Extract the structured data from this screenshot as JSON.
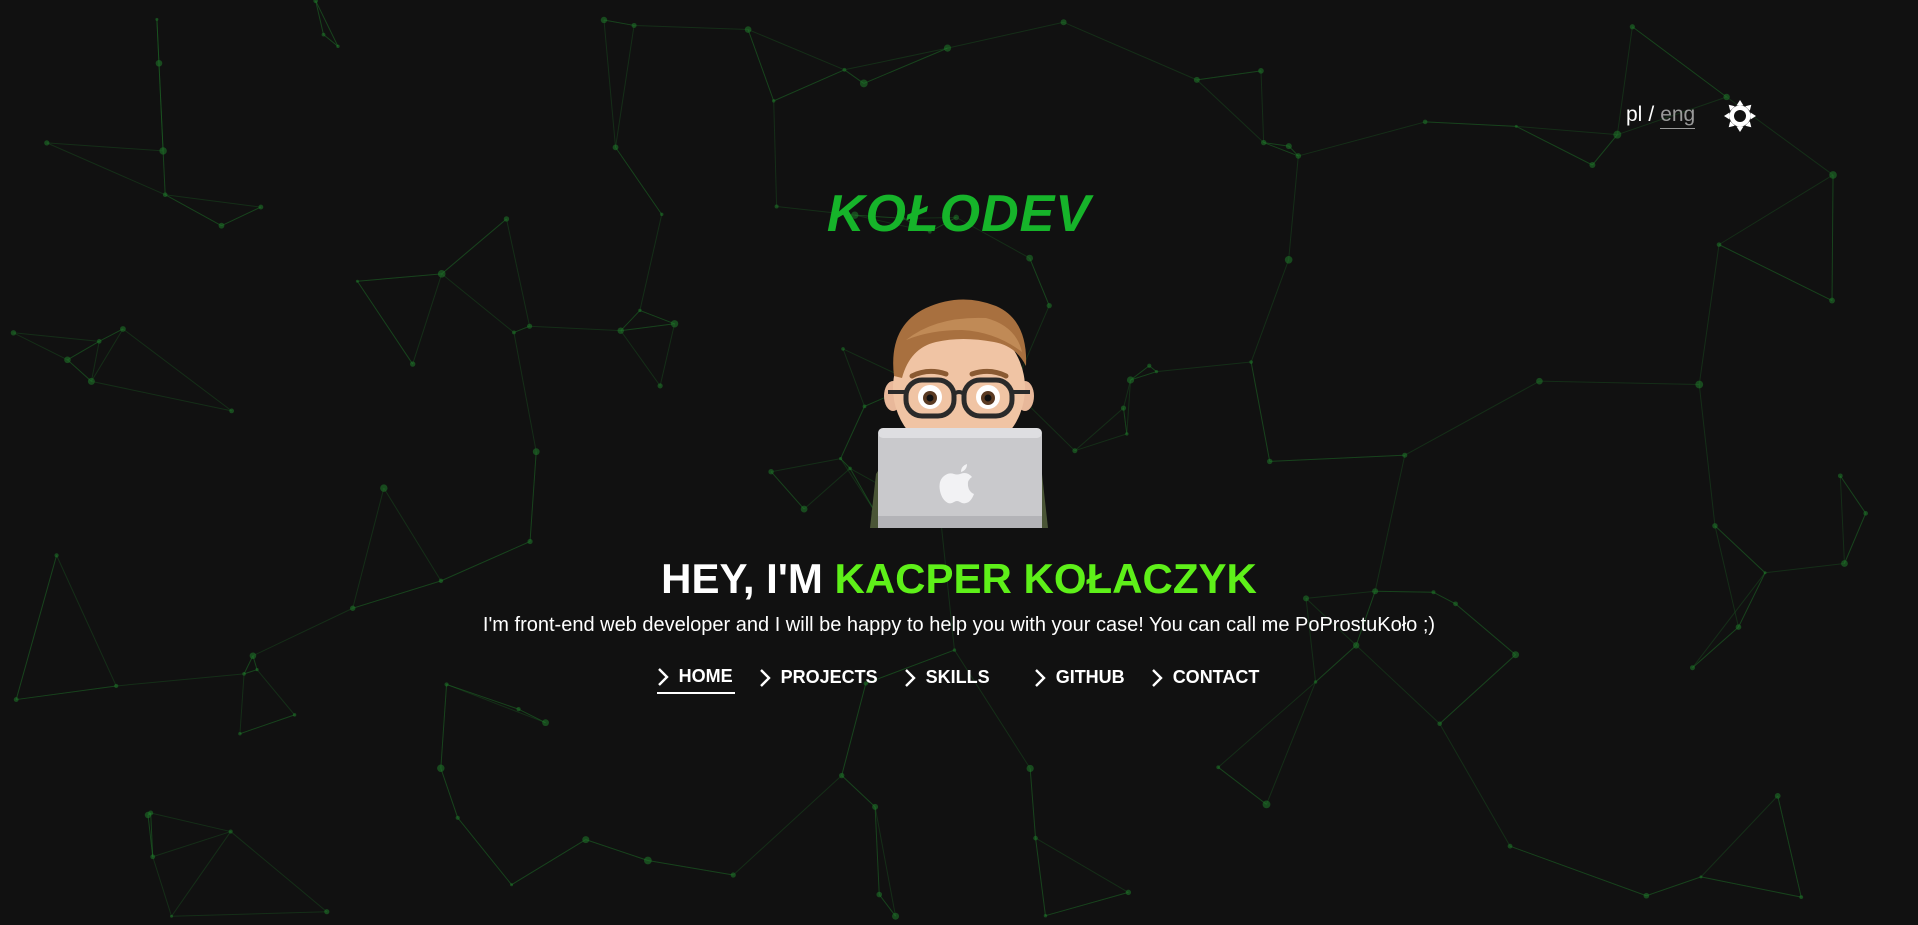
{
  "header": {
    "lang_pl": "pl",
    "lang_sep": "/",
    "lang_eng": "eng",
    "theme_icon": "sun-icon"
  },
  "brand": {
    "title": "KOŁODEV"
  },
  "avatar": {
    "icon": "memoji-avatar-with-laptop"
  },
  "hero": {
    "greeting": "HEY, I'M",
    "name": "KACPER KOŁACZYK",
    "tagline": "I'm front-end web developer and I will be happy to help you with your case! You can call me PoProstuKoło ;)"
  },
  "nav": {
    "items": [
      {
        "label": "HOME",
        "active": true
      },
      {
        "label": "PROJECTS",
        "active": false
      },
      {
        "label": "SKILLS",
        "active": false
      },
      {
        "label": "GITHUB",
        "active": false
      },
      {
        "label": "CONTACT",
        "active": false
      }
    ]
  },
  "colors": {
    "background": "#111111",
    "brand": "#16b42a",
    "name_accent": "#5ef019",
    "network": "#1f7a2a"
  }
}
